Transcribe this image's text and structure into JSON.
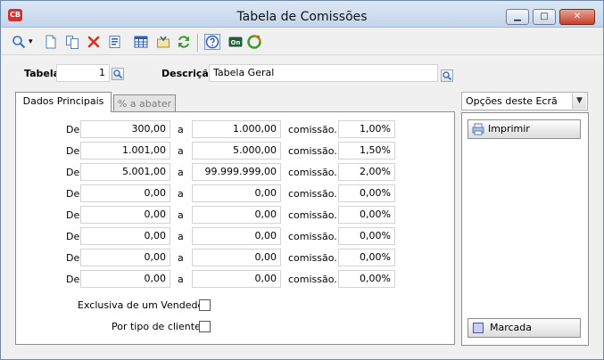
{
  "window": {
    "title": "Tabela de Comissões",
    "minimize_glyph": "▁",
    "maximize_glyph": "□",
    "close_glyph": "✕",
    "app_icon": "app-logo-icon",
    "app_icon_text": "CB"
  },
  "toolbar": {
    "search_dropdown_glyph": "▾",
    "icons": [
      "search-icon",
      "new-document-icon",
      "copy-document-icon",
      "delete-icon",
      "properties-icon",
      "table-grid-icon",
      "export-icon",
      "sync-icon",
      "help-icon",
      "online-icon",
      "refresh-icon"
    ]
  },
  "header": {
    "tabela_label": "Tabela",
    "tabela_value": "1",
    "descricao_label": "Descrição",
    "descricao_value": "Tabela Geral"
  },
  "tabs": [
    {
      "label": "Dados Principais",
      "active": true
    },
    {
      "label": "% a abater",
      "active": false
    }
  ],
  "commission_rows": [
    {
      "de_label": "De",
      "from": "300,00",
      "a_label": "a",
      "to": "1.000,00",
      "comissao_label": "comissão...",
      "percent": "1,00%"
    },
    {
      "de_label": "De",
      "from": "1.001,00",
      "a_label": "a",
      "to": "5.000,00",
      "comissao_label": "comissão...",
      "percent": "1,50%"
    },
    {
      "de_label": "De",
      "from": "5.001,00",
      "a_label": "a",
      "to": "99.999.999,00",
      "comissao_label": "comissão...",
      "percent": "2,00%"
    },
    {
      "de_label": "De",
      "from": "0,00",
      "a_label": "a",
      "to": "0,00",
      "comissao_label": "comissão...",
      "percent": "0,00%"
    },
    {
      "de_label": "De",
      "from": "0,00",
      "a_label": "a",
      "to": "0,00",
      "comissao_label": "comissão...",
      "percent": "0,00%"
    },
    {
      "de_label": "De",
      "from": "0,00",
      "a_label": "a",
      "to": "0,00",
      "comissao_label": "comissão...",
      "percent": "0,00%"
    },
    {
      "de_label": "De",
      "from": "0,00",
      "a_label": "a",
      "to": "0,00",
      "comissao_label": "comissão...",
      "percent": "0,00%"
    },
    {
      "de_label": "De",
      "from": "0,00",
      "a_label": "a",
      "to": "0,00",
      "comissao_label": "comissão...",
      "percent": "0,00%"
    }
  ],
  "checkboxes": {
    "exclusiva_label": "Exclusiva de um Vendedor",
    "exclusiva_checked": false,
    "tipo_cliente_label": "Por tipo de cliente",
    "tipo_cliente_checked": false
  },
  "options": {
    "select_label": "Opções deste Ecrã",
    "imprimir_label": "Imprimir",
    "marcada_label": "Marcada"
  },
  "colors": {
    "accent_blue": "#2f5ea8",
    "delete_red": "#d8311f",
    "sync_green": "#3c9a2e"
  }
}
